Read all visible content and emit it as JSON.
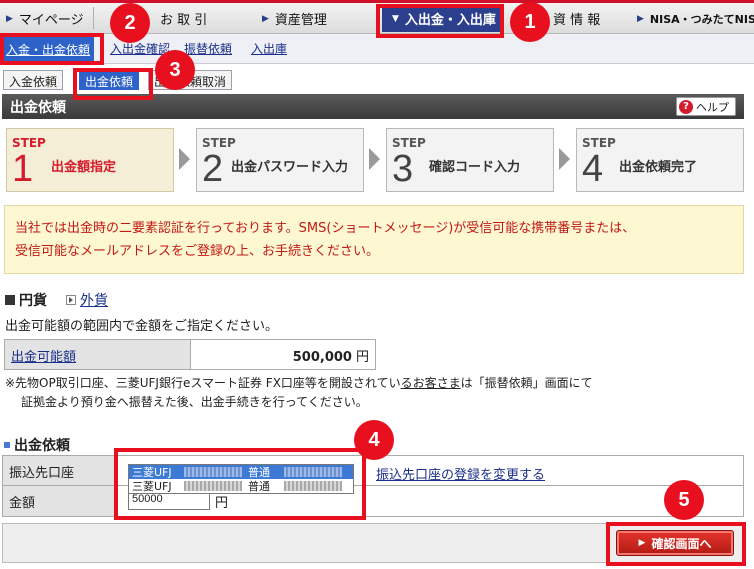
{
  "nav": {
    "items": [
      "マイページ",
      "お 取 引",
      "資産管理",
      "入出金・入出庫",
      "資 情 報",
      "NISA・つみたてNISA"
    ],
    "active_index": 3
  },
  "subnav": {
    "items": [
      "入金・出金依頼",
      "入出金確認",
      "振替依頼",
      "入出庫"
    ]
  },
  "tabs": {
    "items": [
      "入金依頼",
      "出金依頼",
      "出金依頼取消"
    ]
  },
  "title": {
    "text": "出金依頼",
    "help_label": "ヘルプ",
    "help_glyph": "?"
  },
  "steps": [
    {
      "label": "STEP",
      "num": "1",
      "text": "出金額指定"
    },
    {
      "label": "STEP",
      "num": "2",
      "text": "出金パスワード入力"
    },
    {
      "label": "STEP",
      "num": "3",
      "text": "確認コード入力"
    },
    {
      "label": "STEP",
      "num": "4",
      "text": "出金依頼完了"
    }
  ],
  "notice": {
    "line1": "当社では出金時の二要素認証を行っております。SMS(ショートメッセージ)が受信可能な携帯番号または、",
    "line2": "受信可能なメールアドレスをご登録の上、お手続きください。"
  },
  "currency": {
    "jpy": "円貨",
    "foreign": "外貨"
  },
  "desc": "出金可能額の範囲内で金額をご指定ください。",
  "available": {
    "label": "出金可能額",
    "value": "500,000",
    "unit": "円"
  },
  "note": {
    "part1": "※先物OP取引口座、三菱UFJ銀行eスマート証券 FX口座等を開設されてい",
    "part2": "るお客さま",
    "part3": "は「振替依頼」画面にて",
    "line2": "証拠金より預り金へ振替えた後、出金手続きを行ってください。"
  },
  "request": {
    "title": "出金依頼",
    "account_label": "振込先口座",
    "account_options": [
      {
        "bank": "三菱UFJ",
        "type": "普通"
      },
      {
        "bank": "三菱UFJ",
        "type": "普通"
      }
    ],
    "change_link": "振込先口座の登録を変更する",
    "amount_label": "金額",
    "amount_value": "50000",
    "amount_unit": "円"
  },
  "footer": {
    "confirm_label": "確認画面へ"
  },
  "annotations": [
    "1",
    "2",
    "3",
    "4",
    "5"
  ],
  "colors": {
    "annotation": "#e8101e",
    "nav_active": "#2b3f8c",
    "tab_active": "#2d63c8",
    "notice_text": "#c01a14",
    "step_current": "#d41c2c"
  }
}
